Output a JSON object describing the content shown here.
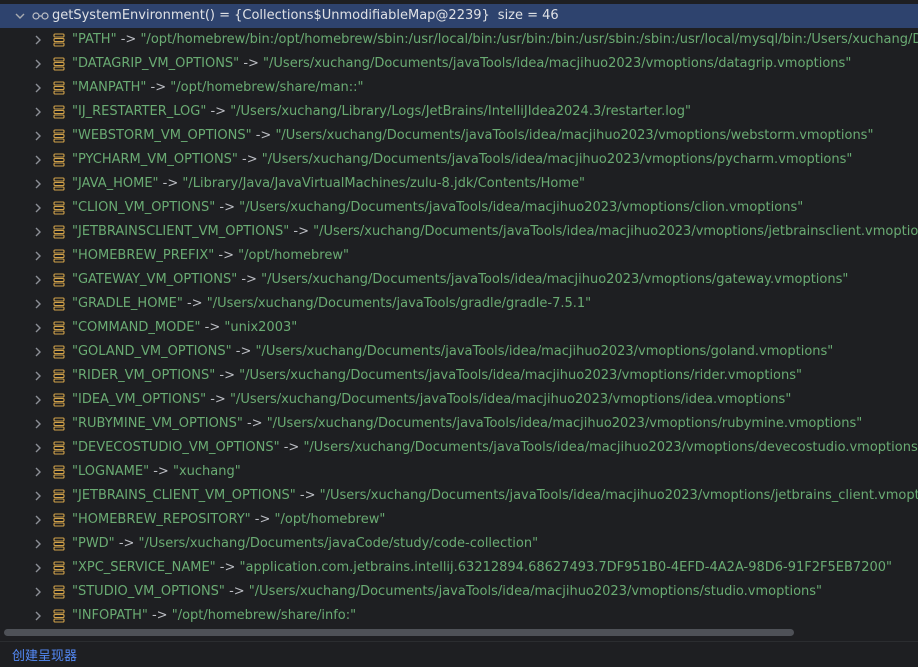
{
  "root": {
    "label": "getSystemEnvironment() = {Collections$UnmodifiableMap@2239}",
    "size": "size = 46"
  },
  "entries": [
    {
      "key": "\"PATH\"",
      "value": "\"/opt/homebrew/bin:/opt/homebrew/sbin:/usr/local/bin:/usr/bin:/bin:/usr/sbin:/sbin:/usr/local/mysql/bin:/Users/xuchang/Documer"
    },
    {
      "key": "\"DATAGRIP_VM_OPTIONS\"",
      "value": "\"/Users/xuchang/Documents/javaTools/idea/macjihuo2023/vmoptions/datagrip.vmoptions\""
    },
    {
      "key": "\"MANPATH\"",
      "value": "\"/opt/homebrew/share/man::\""
    },
    {
      "key": "\"IJ_RESTARTER_LOG\"",
      "value": "\"/Users/xuchang/Library/Logs/JetBrains/IntelliJIdea2024.3/restarter.log\""
    },
    {
      "key": "\"WEBSTORM_VM_OPTIONS\"",
      "value": "\"/Users/xuchang/Documents/javaTools/idea/macjihuo2023/vmoptions/webstorm.vmoptions\""
    },
    {
      "key": "\"PYCHARM_VM_OPTIONS\"",
      "value": "\"/Users/xuchang/Documents/javaTools/idea/macjihuo2023/vmoptions/pycharm.vmoptions\""
    },
    {
      "key": "\"JAVA_HOME\"",
      "value": "\"/Library/Java/JavaVirtualMachines/zulu-8.jdk/Contents/Home\""
    },
    {
      "key": "\"CLION_VM_OPTIONS\"",
      "value": "\"/Users/xuchang/Documents/javaTools/idea/macjihuo2023/vmoptions/clion.vmoptions\""
    },
    {
      "key": "\"JETBRAINSCLIENT_VM_OPTIONS\"",
      "value": "\"/Users/xuchang/Documents/javaTools/idea/macjihuo2023/vmoptions/jetbrainsclient.vmoptions\""
    },
    {
      "key": "\"HOMEBREW_PREFIX\"",
      "value": "\"/opt/homebrew\""
    },
    {
      "key": "\"GATEWAY_VM_OPTIONS\"",
      "value": "\"/Users/xuchang/Documents/javaTools/idea/macjihuo2023/vmoptions/gateway.vmoptions\""
    },
    {
      "key": "\"GRADLE_HOME\"",
      "value": "\"/Users/xuchang/Documents/javaTools/gradle/gradle-7.5.1\""
    },
    {
      "key": "\"COMMAND_MODE\"",
      "value": "\"unix2003\""
    },
    {
      "key": "\"GOLAND_VM_OPTIONS\"",
      "value": "\"/Users/xuchang/Documents/javaTools/idea/macjihuo2023/vmoptions/goland.vmoptions\""
    },
    {
      "key": "\"RIDER_VM_OPTIONS\"",
      "value": "\"/Users/xuchang/Documents/javaTools/idea/macjihuo2023/vmoptions/rider.vmoptions\""
    },
    {
      "key": "\"IDEA_VM_OPTIONS\"",
      "value": "\"/Users/xuchang/Documents/javaTools/idea/macjihuo2023/vmoptions/idea.vmoptions\""
    },
    {
      "key": "\"RUBYMINE_VM_OPTIONS\"",
      "value": "\"/Users/xuchang/Documents/javaTools/idea/macjihuo2023/vmoptions/rubymine.vmoptions\""
    },
    {
      "key": "\"DEVECOSTUDIO_VM_OPTIONS\"",
      "value": "\"/Users/xuchang/Documents/javaTools/idea/macjihuo2023/vmoptions/devecostudio.vmoptions\""
    },
    {
      "key": "\"LOGNAME\"",
      "value": "\"xuchang\""
    },
    {
      "key": "\"JETBRAINS_CLIENT_VM_OPTIONS\"",
      "value": "\"/Users/xuchang/Documents/javaTools/idea/macjihuo2023/vmoptions/jetbrains_client.vmoptions\""
    },
    {
      "key": "\"HOMEBREW_REPOSITORY\"",
      "value": "\"/opt/homebrew\""
    },
    {
      "key": "\"PWD\"",
      "value": "\"/Users/xuchang/Documents/javaCode/study/code-collection\""
    },
    {
      "key": "\"XPC_SERVICE_NAME\"",
      "value": "\"application.com.jetbrains.intellij.63212894.68627493.7DF951B0-4EFD-4A2A-98D6-91F2F5EB7200\""
    },
    {
      "key": "\"STUDIO_VM_OPTIONS\"",
      "value": "\"/Users/xuchang/Documents/javaTools/idea/macjihuo2023/vmoptions/studio.vmoptions\""
    },
    {
      "key": "\"INFOPATH\"",
      "value": "\"/opt/homebrew/share/info:\""
    }
  ],
  "arrow": "->",
  "footer": {
    "create_renderer_link": "创建呈现器"
  },
  "icons": {
    "root": "watch-glasses-icon",
    "field": "map-entry-icon",
    "expand": "chevron-right-icon",
    "collapse": "chevron-down-icon"
  },
  "colors": {
    "selection": "#2e436e",
    "string": "#6aab73",
    "link": "#548af7",
    "background": "#1e1f22"
  }
}
